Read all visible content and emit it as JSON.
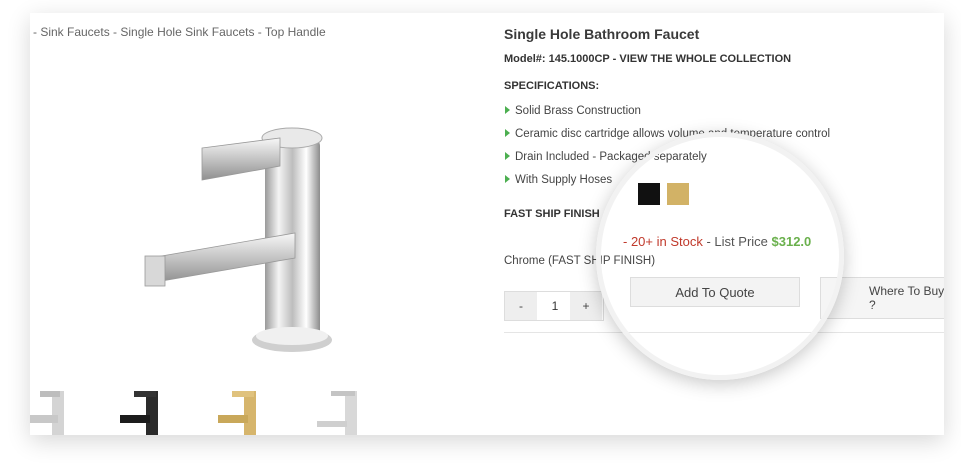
{
  "breadcrumb": {
    "items": [
      "- Sink Faucets",
      "- Single Hole Sink Faucets",
      "- Top Handle"
    ]
  },
  "product": {
    "title": "Single Hole Bathroom Faucet",
    "model_prefix": "Model#: 145.1000CP",
    "collection_link": "VIEW THE WHOLE COLLECTION",
    "specs_heading": "SPECIFICATIONS:",
    "specs": [
      "Solid Brass Construction",
      "Ceramic disc cartridge allows volume and temperature control",
      "Drain Included - Packaged separately",
      "With Supply Hoses"
    ],
    "finish_heading": "FAST SHIP FINISH",
    "finish_swatches": [
      {
        "name": "Matte Black",
        "color": "#111111"
      },
      {
        "name": "Brushed Gold",
        "color": "#d2b266"
      }
    ],
    "stock_text": "- 20+ in Stock",
    "list_price_label": "- List Price",
    "price": "$312.0",
    "selected_finish": "Chrome (FAST SHIP FINISH)",
    "quantity": "1",
    "qty_minus": "-",
    "qty_plus": "+",
    "add_to_quote": "Add To Quote",
    "where_to_buy": "Where To Buy ?"
  },
  "colors": {
    "stock_red": "#c0392b",
    "price_green": "#6ab04c",
    "bullet_green": "#4caf50"
  },
  "thumbnails": [
    "chrome",
    "black",
    "gold",
    "chrome-alt"
  ]
}
